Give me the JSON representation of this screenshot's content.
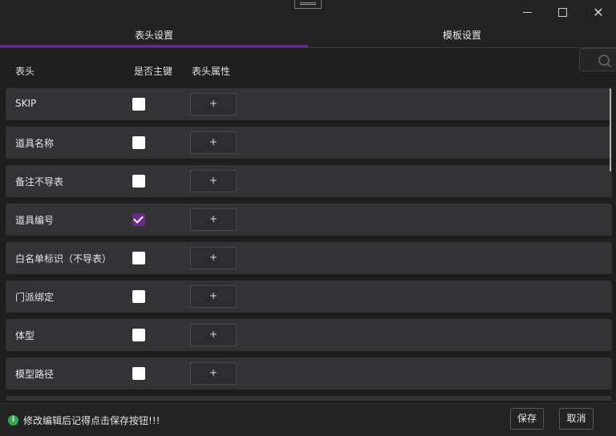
{
  "window": {
    "minimize_glyph": "",
    "close_glyph": "✕"
  },
  "tabs": [
    {
      "label": "表头设置",
      "active": true
    },
    {
      "label": "模板设置",
      "active": false
    }
  ],
  "accent_color": "#6b2a8a",
  "table": {
    "headers": [
      "表头",
      "是否主键",
      "表头属性"
    ],
    "add_label": "+",
    "rows": [
      {
        "name": "SKIP",
        "primary_key": false
      },
      {
        "name": "道具名称",
        "primary_key": false
      },
      {
        "name": "备注不导表",
        "primary_key": false
      },
      {
        "name": "道具编号",
        "primary_key": true
      },
      {
        "name": "白名单标识（不导表）",
        "primary_key": false
      },
      {
        "name": "门派绑定",
        "primary_key": false
      },
      {
        "name": "体型",
        "primary_key": false
      },
      {
        "name": "模型路径",
        "primary_key": false
      }
    ]
  },
  "footer": {
    "message": "修改编辑后记得点击保存按钮!!!",
    "info_icon": "i",
    "save_label": "保存",
    "cancel_label": "取消"
  }
}
